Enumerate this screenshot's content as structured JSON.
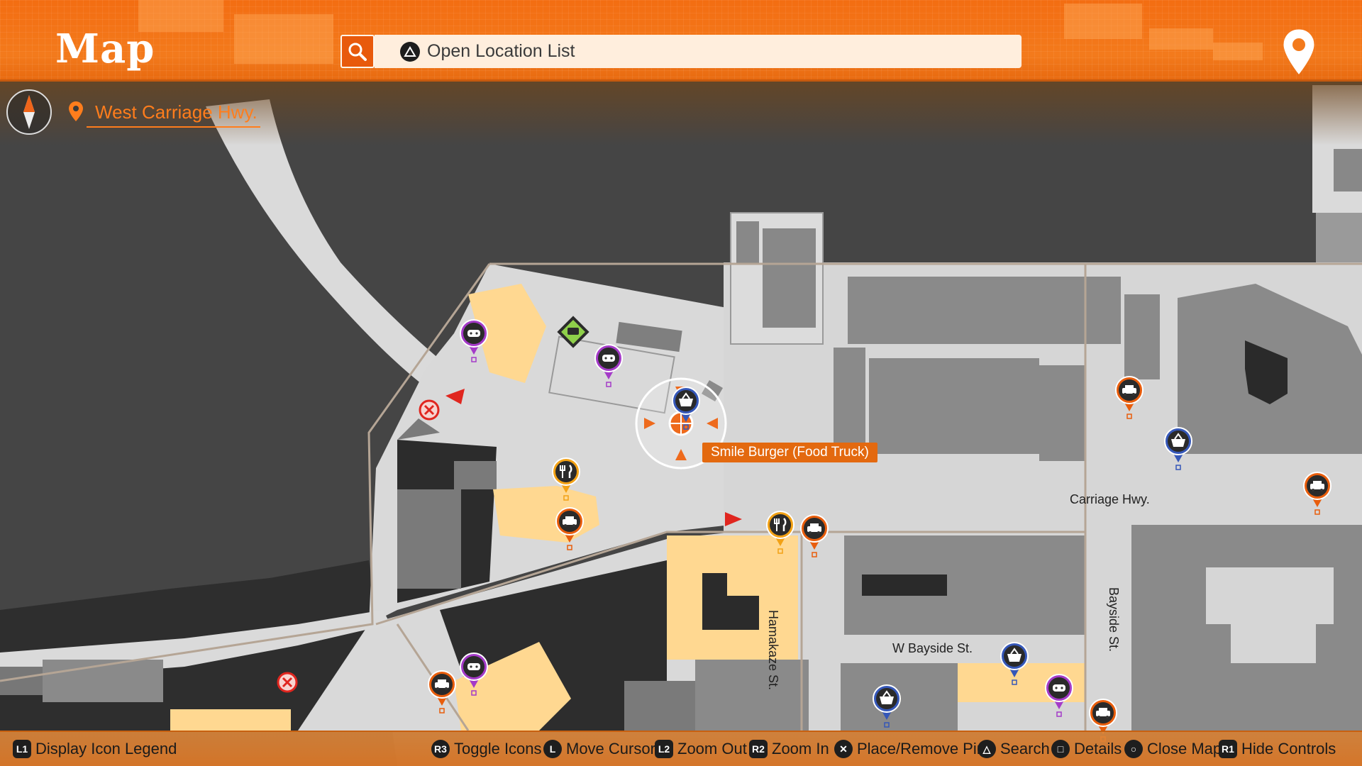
{
  "header": {
    "title": "Map",
    "search_prompt": "Open Location List"
  },
  "location": {
    "name": "West Carriage Hwy."
  },
  "target": {
    "label": "Smile Burger (Food Truck)"
  },
  "streets": {
    "carriage_hwy": "Carriage Hwy.",
    "w_bayside": "W Bayside St.",
    "hamakaze": "Hamakaze St.",
    "bayside": "Bayside St."
  },
  "controls": [
    {
      "button": "L1",
      "label": "Display Icon Legend"
    },
    {
      "button": "R3",
      "label": "Toggle Icons"
    },
    {
      "button": "L",
      "label": "Move Cursor"
    },
    {
      "button": "L2",
      "label": "Zoom Out"
    },
    {
      "button": "R2",
      "label": "Zoom In"
    },
    {
      "button": "✕",
      "label": "Place/Remove Pin"
    },
    {
      "button": "△",
      "label": "Search"
    },
    {
      "button": "□",
      "label": "Details"
    },
    {
      "button": "○",
      "label": "Close Map"
    },
    {
      "button": "R1",
      "label": "Hide Controls"
    }
  ],
  "colors": {
    "accent": "#f36d12",
    "highlight_building": "#ffd891",
    "road": "#d9d9d9",
    "water": "#3c3c3c",
    "marker_game": "#a43ac8",
    "marker_taxi": "#e85d0c",
    "marker_food": "#f2a115",
    "marker_shop": "#3557b8"
  }
}
